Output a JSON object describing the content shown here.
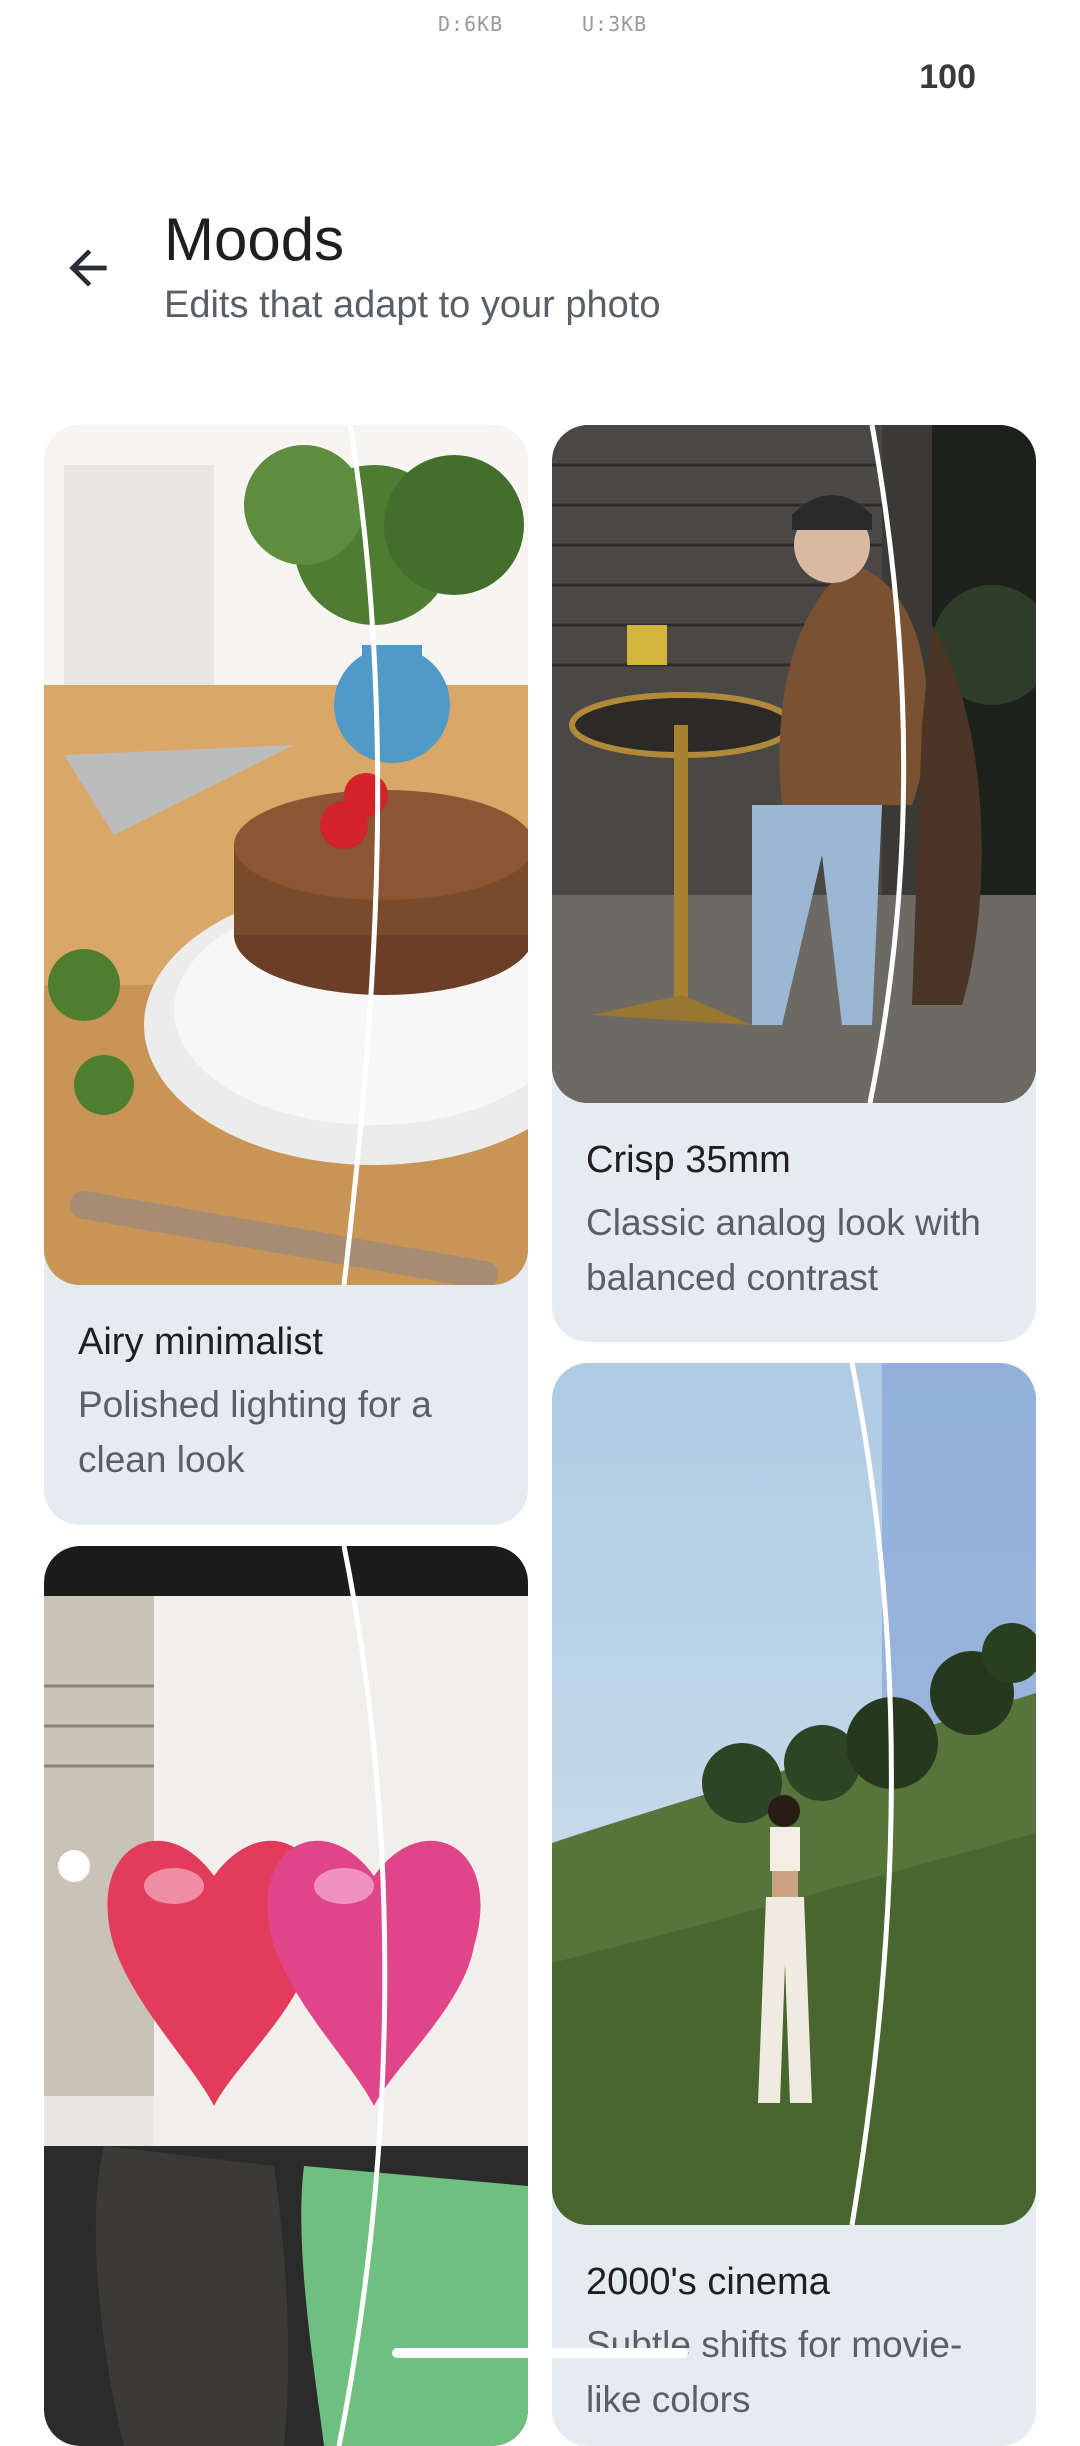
{
  "status_bar": {
    "download": "D:6KB",
    "upload": "U:3KB",
    "battery": "100"
  },
  "header": {
    "title": "Moods",
    "subtitle": "Edits that adapt to your photo"
  },
  "cards": [
    {
      "title": "Airy minimalist",
      "description": "Polished lighting for a clean look",
      "photo": "cake-photo"
    },
    {
      "title": "Crisp 35mm",
      "description": "Classic analog look with balanced contrast",
      "photo": "cafe-photo"
    },
    {
      "title": "",
      "description": "",
      "photo": "balloons-photo"
    },
    {
      "title": "2000's cinema",
      "description": "Subtle shifts for movie-like colors",
      "photo": "hillside-photo"
    }
  ]
}
